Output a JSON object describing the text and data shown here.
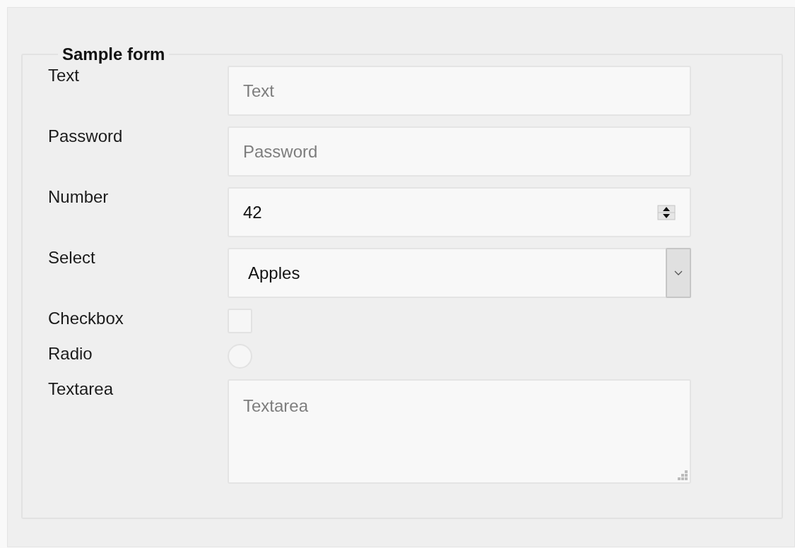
{
  "form": {
    "title": "Sample form",
    "fields": [
      {
        "kind": "text",
        "label": "Text",
        "placeholder": "Text"
      },
      {
        "kind": "password",
        "label": "Password",
        "placeholder": "Password"
      },
      {
        "kind": "number",
        "label": "Number",
        "value": "42"
      },
      {
        "kind": "select",
        "label": "Select",
        "value": "Apples"
      },
      {
        "kind": "checkbox",
        "label": "Checkbox",
        "checked": false
      },
      {
        "kind": "radio",
        "label": "Radio",
        "selected": false
      },
      {
        "kind": "textarea",
        "label": "Textarea",
        "placeholder": "Textarea"
      }
    ]
  }
}
